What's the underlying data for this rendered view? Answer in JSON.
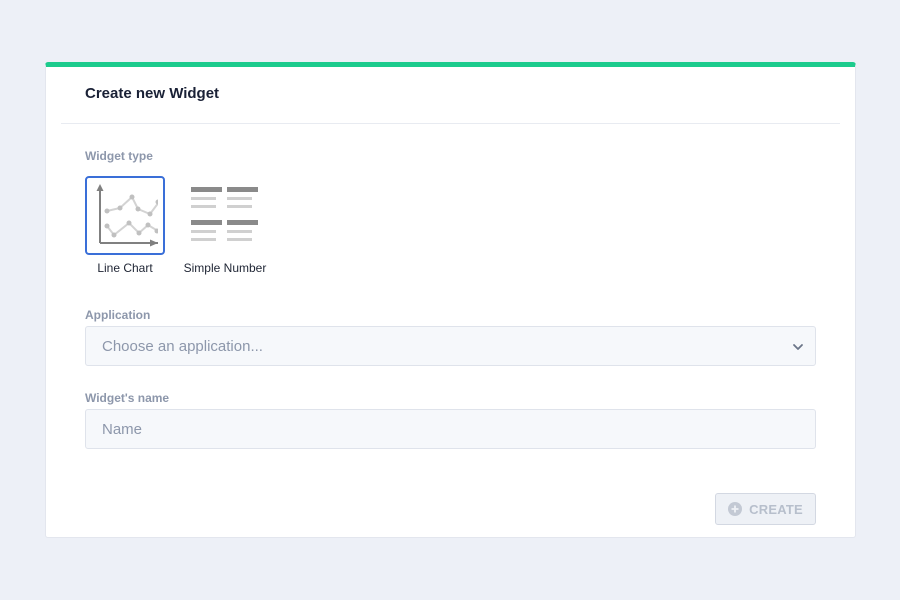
{
  "modal": {
    "title": "Create new Widget",
    "accent_color": "#1ccb8d"
  },
  "widget_type": {
    "label": "Widget type",
    "options": [
      {
        "label": "Line Chart",
        "icon": "line-chart-icon",
        "selected": true
      },
      {
        "label": "Simple Number",
        "icon": "simple-number-icon",
        "selected": false
      }
    ]
  },
  "application": {
    "label": "Application",
    "placeholder": "Choose an application...",
    "icon": "chevron-down-icon"
  },
  "widget_name": {
    "label": "Widget's name",
    "placeholder": "Name"
  },
  "create_button": {
    "label": "CREATE",
    "icon": "plus-circle-icon",
    "disabled": true
  }
}
